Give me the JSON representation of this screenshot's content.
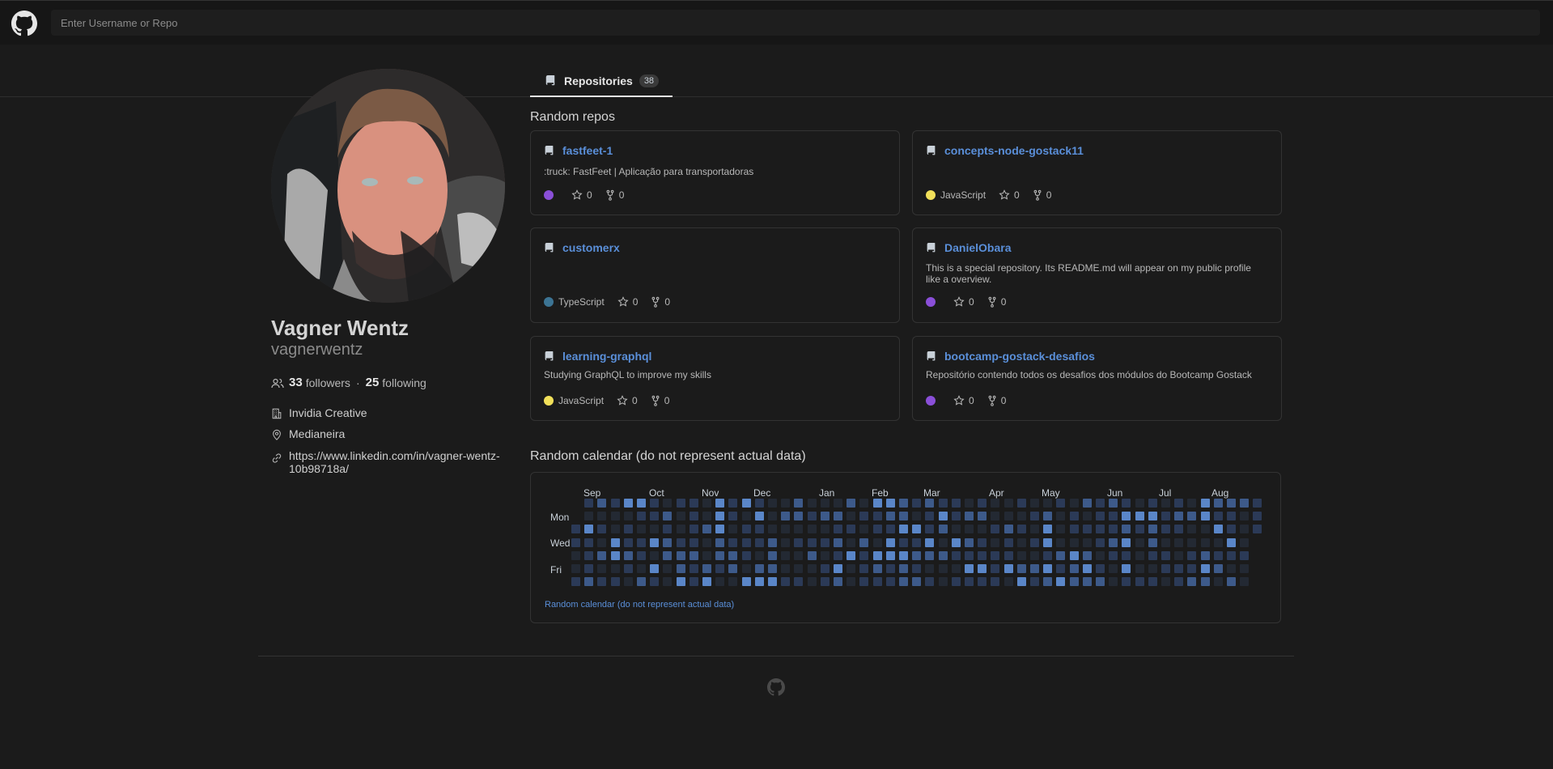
{
  "header": {
    "search_placeholder": "Enter Username or Repo"
  },
  "tabs": [
    {
      "label": "Repositories",
      "count": "38"
    }
  ],
  "profile": {
    "name": "Vagner Wentz",
    "login": "vagnerwentz",
    "followers_count": "33",
    "followers_label": "followers",
    "following_count": "25",
    "following_label": "following",
    "separator": "·",
    "company": "Invidia Creative",
    "location": "Medianeira",
    "website": "https://www.linkedin.com/in/vagner-wentz-10b98718a/"
  },
  "repos_section": {
    "title": "Random repos",
    "repos": [
      {
        "name": "fastfeet-1",
        "description": ":truck: FastFeet | Aplicação para transportadoras",
        "language": "",
        "lang_color": "#8a4fd8",
        "stars": "0",
        "forks": "0"
      },
      {
        "name": "concepts-node-gostack11",
        "description": "",
        "language": "JavaScript",
        "lang_color": "#f1e05a",
        "stars": "0",
        "forks": "0"
      },
      {
        "name": "customerx",
        "description": "",
        "language": "TypeScript",
        "lang_color": "#3c7494",
        "stars": "0",
        "forks": "0"
      },
      {
        "name": "DanielObara",
        "description": "This is a special repository. Its README.md will appear on my public profile like a overview.",
        "language": "",
        "lang_color": "#8a4fd8",
        "stars": "0",
        "forks": "0"
      },
      {
        "name": "learning-graphql",
        "description": "Studying GraphQL to improve my skills",
        "language": "JavaScript",
        "lang_color": "#f1e05a",
        "stars": "0",
        "forks": "0"
      },
      {
        "name": "bootcamp-gostack-desafios",
        "description": "Repositório contendo todos os desafios dos módulos do Bootcamp Gostack",
        "language": "",
        "lang_color": "#8a4fd8",
        "stars": "0",
        "forks": "0"
      }
    ]
  },
  "calendar": {
    "title": "Random calendar (do not represent actual data)",
    "months": [
      "Sep",
      "Oct",
      "Nov",
      "Dec",
      "Jan",
      "Feb",
      "Mar",
      "Apr",
      "May",
      "Jun",
      "Jul",
      "Aug"
    ],
    "days": [
      "Mon",
      "Wed",
      "Fri"
    ],
    "footer": "Random calendar (do not represent actual data)",
    "colors": [
      "#232933",
      "#2b3a57",
      "#3d5a8a",
      "#5a86c8"
    ]
  }
}
